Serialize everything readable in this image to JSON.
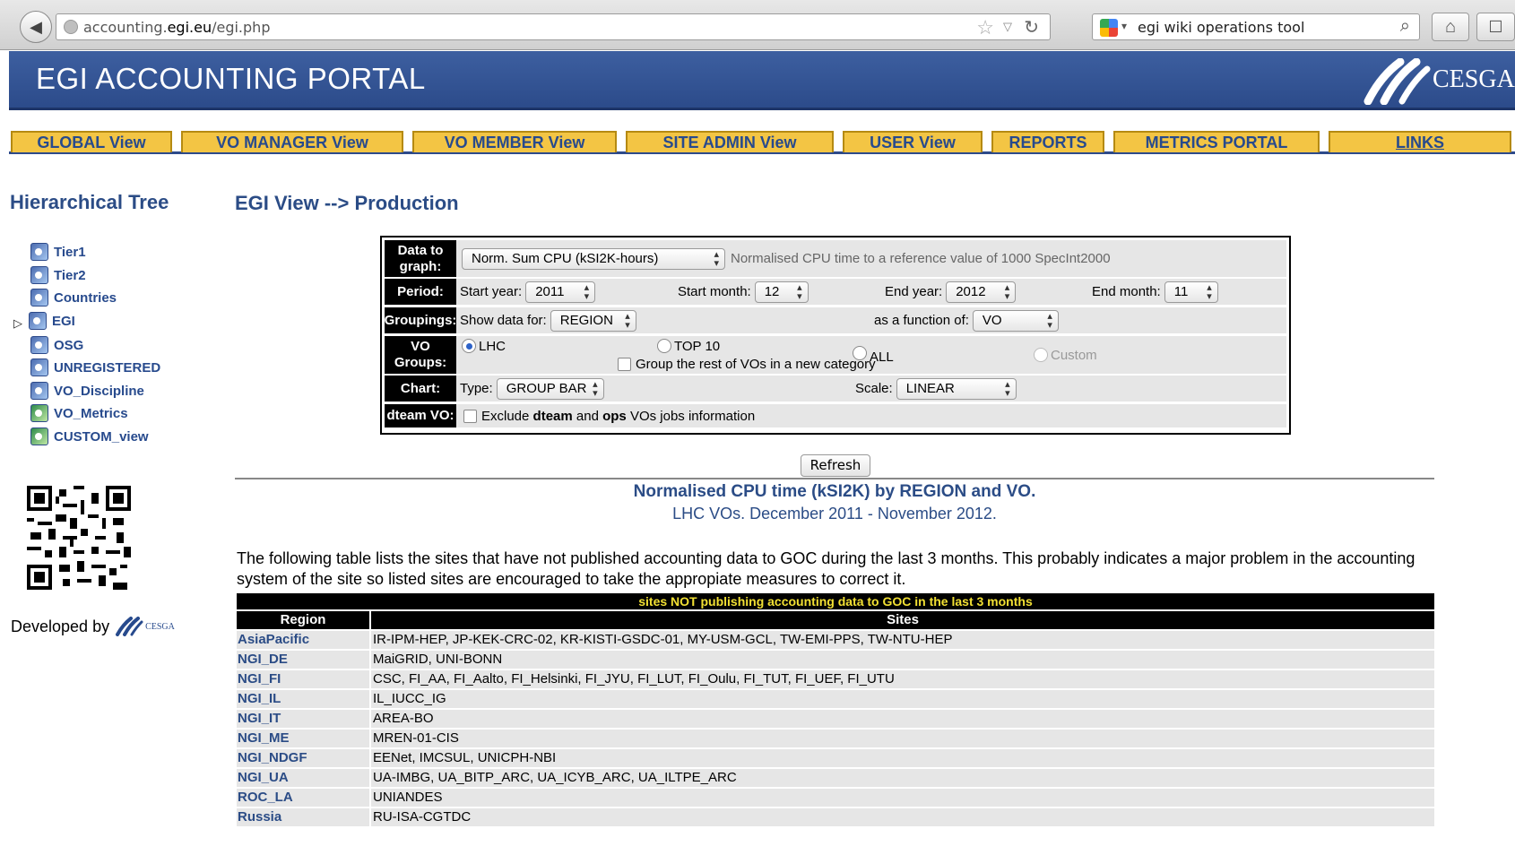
{
  "browser": {
    "url_prefix": "accounting.",
    "url_host": "egi.eu",
    "url_path": "/egi.php",
    "search_query": "egi wiki operations tool"
  },
  "header": {
    "title": "EGI ACCOUNTING PORTAL",
    "logo_text": "CESGA"
  },
  "nav": {
    "tabs": [
      {
        "label": "GLOBAL View"
      },
      {
        "label": "VO MANAGER View"
      },
      {
        "label": "VO MEMBER View"
      },
      {
        "label": "SITE ADMIN View"
      },
      {
        "label": "USER View"
      },
      {
        "label": "REPORTS"
      },
      {
        "label": "METRICS PORTAL"
      },
      {
        "label": "LINKS"
      }
    ]
  },
  "sidebar": {
    "title": "Hierarchical Tree",
    "items": [
      {
        "label": "Tier1"
      },
      {
        "label": "Tier2"
      },
      {
        "label": "Countries"
      },
      {
        "label": "EGI"
      },
      {
        "label": "OSG"
      },
      {
        "label": "UNREGISTERED"
      },
      {
        "label": "VO_Discipline"
      },
      {
        "label": "VO_Metrics"
      },
      {
        "label": "CUSTOM_view"
      }
    ],
    "developed_by": "Developed by",
    "dev_logo_text": "CESGA"
  },
  "main": {
    "title": "EGI View --> Production"
  },
  "form": {
    "data_label": "Data to graph:",
    "data_value": "Norm. Sum CPU (kSI2K-hours)",
    "data_desc": "Normalised CPU time to a reference value of 1000 SpecInt2000",
    "period_label": "Period:",
    "start_year_label": "Start year:",
    "start_year": "2011",
    "start_month_label": "Start month:",
    "start_month": "12",
    "end_year_label": "End year:",
    "end_year": "2012",
    "end_month_label": "End month:",
    "end_month": "11",
    "groupings_label": "Groupings:",
    "show_label": "Show data for:",
    "show_value": "REGION",
    "func_label": "as a function of:",
    "func_value": "VO",
    "vo_label": "VO Groups:",
    "opt_lhc": "LHC",
    "opt_top10": "TOP 10",
    "opt_all": "ALL",
    "opt_custom": "Custom",
    "group_rest": "Group the rest of VOs in a new category",
    "chart_label": "Chart:",
    "type_label": "Type:",
    "type_value": "GROUP BAR",
    "scale_label": "Scale:",
    "scale_value": "LINEAR",
    "dteam_label": "dteam VO:",
    "dteam_pre": "Exclude ",
    "dteam_b1": "dteam",
    "dteam_mid": " and ",
    "dteam_b2": "ops",
    "dteam_post": " VOs jobs information"
  },
  "refresh_label": "Refresh",
  "chart": {
    "title": "Normalised CPU time (kSI2K) by REGION and VO.",
    "subtitle": "LHC VOs. December 2011 - November 2012."
  },
  "description": "The following table lists the sites that have not published accounting data to GOC during the last 3 months. This probably indicates a major problem in the accounting system of the site so listed sites are encouraged to take the appropiate measures to correct it.",
  "table": {
    "caption": "sites NOT publishing accounting data to GOC in the last 3 months",
    "col_region": "Region",
    "col_sites": "Sites",
    "rows": [
      {
        "region": "AsiaPacific",
        "sites": "IR-IPM-HEP, JP-KEK-CRC-02, KR-KISTI-GSDC-01, MY-USM-GCL, TW-EMI-PPS, TW-NTU-HEP"
      },
      {
        "region": "NGI_DE",
        "sites": "MaiGRID, UNI-BONN"
      },
      {
        "region": "NGI_FI",
        "sites": "CSC, FI_AA, FI_Aalto, FI_Helsinki, FI_JYU, FI_LUT, FI_Oulu, FI_TUT, FI_UEF, FI_UTU"
      },
      {
        "region": "NGI_IL",
        "sites": "IL_IUCC_IG"
      },
      {
        "region": "NGI_IT",
        "sites": "AREA-BO"
      },
      {
        "region": "NGI_ME",
        "sites": "MREN-01-CIS"
      },
      {
        "region": "NGI_NDGF",
        "sites": "EENet, IMCSUL, UNICPH-NBI"
      },
      {
        "region": "NGI_UA",
        "sites": "UA-IMBG, UA_BITP_ARC, UA_ICYB_ARC, UA_ILTPE_ARC"
      },
      {
        "region": "ROC_LA",
        "sites": "UNIANDES"
      },
      {
        "region": "Russia",
        "sites": "RU-ISA-CGTDC"
      }
    ]
  }
}
